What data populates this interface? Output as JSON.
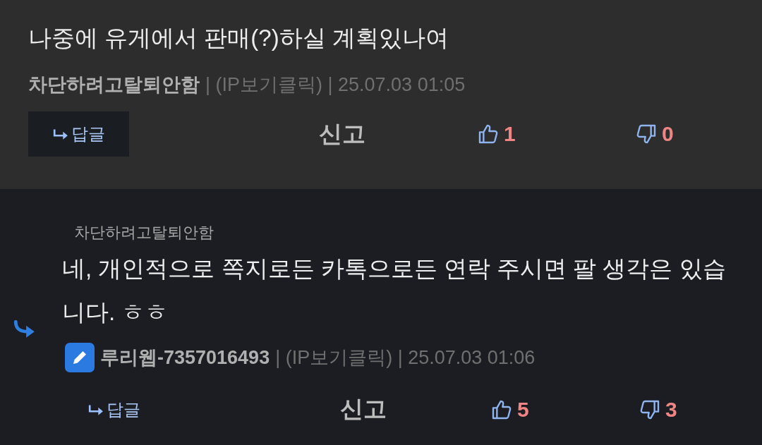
{
  "comment": {
    "text": "나중에 유게에서 판매(?)하실 계획있나여",
    "author": "차단하려고탈퇴안함",
    "meta": "| (IP보기클릭) | 25.07.03 01:05",
    "reply_label": "답글",
    "report_label": "신고",
    "likes": "1",
    "dislikes": "0"
  },
  "reply": {
    "quote_author": "차단하려고탈퇴안함",
    "text": "네, 개인적으로 쪽지로든 카톡으로든 연락 주시면 팔 생각은 있습니다. ㅎㅎ",
    "author": "루리웹-7357016493",
    "meta": "| (IP보기클릭) | 25.07.03 01:06",
    "reply_label": "답글",
    "report_label": "신고",
    "likes": "5",
    "dislikes": "3"
  }
}
